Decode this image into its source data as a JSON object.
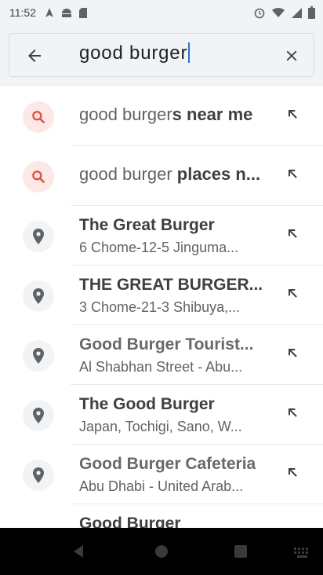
{
  "status": {
    "time": "11:52",
    "notification_icons": [
      "navigation-icon",
      "android-icon",
      "sd-card-icon"
    ],
    "system_icons": [
      "alarm-icon",
      "wifi-icon",
      "signal-icon",
      "battery-icon"
    ]
  },
  "search": {
    "query": "good burger",
    "back_icon": "arrow-left-icon",
    "clear_icon": "close-icon"
  },
  "suggestions": [
    {
      "kind": "search",
      "icon": "search-icon",
      "title_match": "good burger",
      "title_rest": "s near me"
    },
    {
      "kind": "search",
      "icon": "search-icon",
      "title_match": "good burger",
      "title_rest": " places n..."
    },
    {
      "kind": "place",
      "icon": "place-pin-icon",
      "title": "The Great Burger",
      "subtitle": "6 Chome-12-5 Jinguma..."
    },
    {
      "kind": "place",
      "icon": "place-pin-icon",
      "title": "THE GREAT BURGER...",
      "subtitle": "3 Chome-21-3 Shibuya,..."
    },
    {
      "kind": "place",
      "icon": "place-pin-icon",
      "title": "Good Burger Tourist...",
      "subtitle": "Al Shabhan Street - Abu..."
    },
    {
      "kind": "place",
      "icon": "place-pin-icon",
      "title": "The Good Burger",
      "subtitle": "Japan, Tochigi, Sano, W..."
    },
    {
      "kind": "place",
      "icon": "place-pin-icon",
      "title": "Good Burger Cafeteria",
      "subtitle": "Abu Dhabi - United Arab..."
    },
    {
      "kind": "place",
      "icon": "place-pin-icon",
      "title": "Good Burger",
      "subtitle": ""
    }
  ],
  "nav": {
    "icons": [
      "back-triangle-icon",
      "home-circle-icon",
      "recents-square-icon",
      "keyboard-icon"
    ]
  },
  "colors": {
    "accent": "#1a73e8",
    "search_badge": "#fce8e6",
    "search_icon": "#ea4335",
    "place_icon": "#5f6368",
    "bar_bg": "#f1f3f4"
  }
}
